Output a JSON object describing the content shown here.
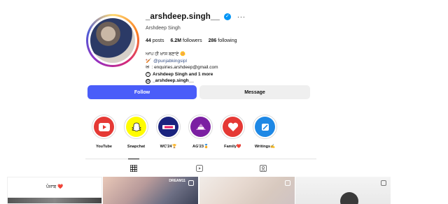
{
  "profile": {
    "username": "_arshdeep.singh__",
    "full_name": "Arshdeep Singh",
    "stats": {
      "posts": "44",
      "posts_label": "posts",
      "followers": "6.2M",
      "followers_label": "followers",
      "following": "286",
      "following_label": "following"
    },
    "bio": {
      "line1": "ਆਪ ਹੀ ਖ਼ਾਸ ਬਣਾਏ 🌼",
      "mention": "@punjabkingsipl",
      "email": ": enquiries.arshdeep@gmail.com",
      "followed_by": "Arshdeep Singh and 1 more",
      "threads": "_arshdeep.singh__"
    }
  },
  "buttons": {
    "follow": "Follow",
    "message": "Message"
  },
  "highlights": [
    {
      "label": "YouTube",
      "icon": "youtube-icon",
      "color": "#e53935"
    },
    {
      "label": "Snapchat",
      "icon": "snapchat-icon",
      "color": "#fffc00"
    },
    {
      "label": "WC'24🏆",
      "icon": "wc24-icon",
      "color": "#1a237e"
    },
    {
      "label": "AG'23🏅",
      "icon": "ag23-icon",
      "color": "#7b1fa2"
    },
    {
      "label": "Family❤️",
      "icon": "heart-icon",
      "color": "#e53935"
    },
    {
      "label": "Writings✍️",
      "icon": "pen-icon",
      "color": "#1e88e5"
    }
  ],
  "tabs": [
    {
      "name": "posts",
      "icon": "grid-icon"
    },
    {
      "name": "reels",
      "icon": "reels-icon"
    },
    {
      "name": "tagged",
      "icon": "tagged-icon"
    }
  ],
  "posts": {
    "first_caption": "ਪੰਜਾਬ ❤️",
    "second_brand": "DREAM11"
  },
  "colors": {
    "accent": "#4a5df9",
    "verified": "#0095f6"
  }
}
